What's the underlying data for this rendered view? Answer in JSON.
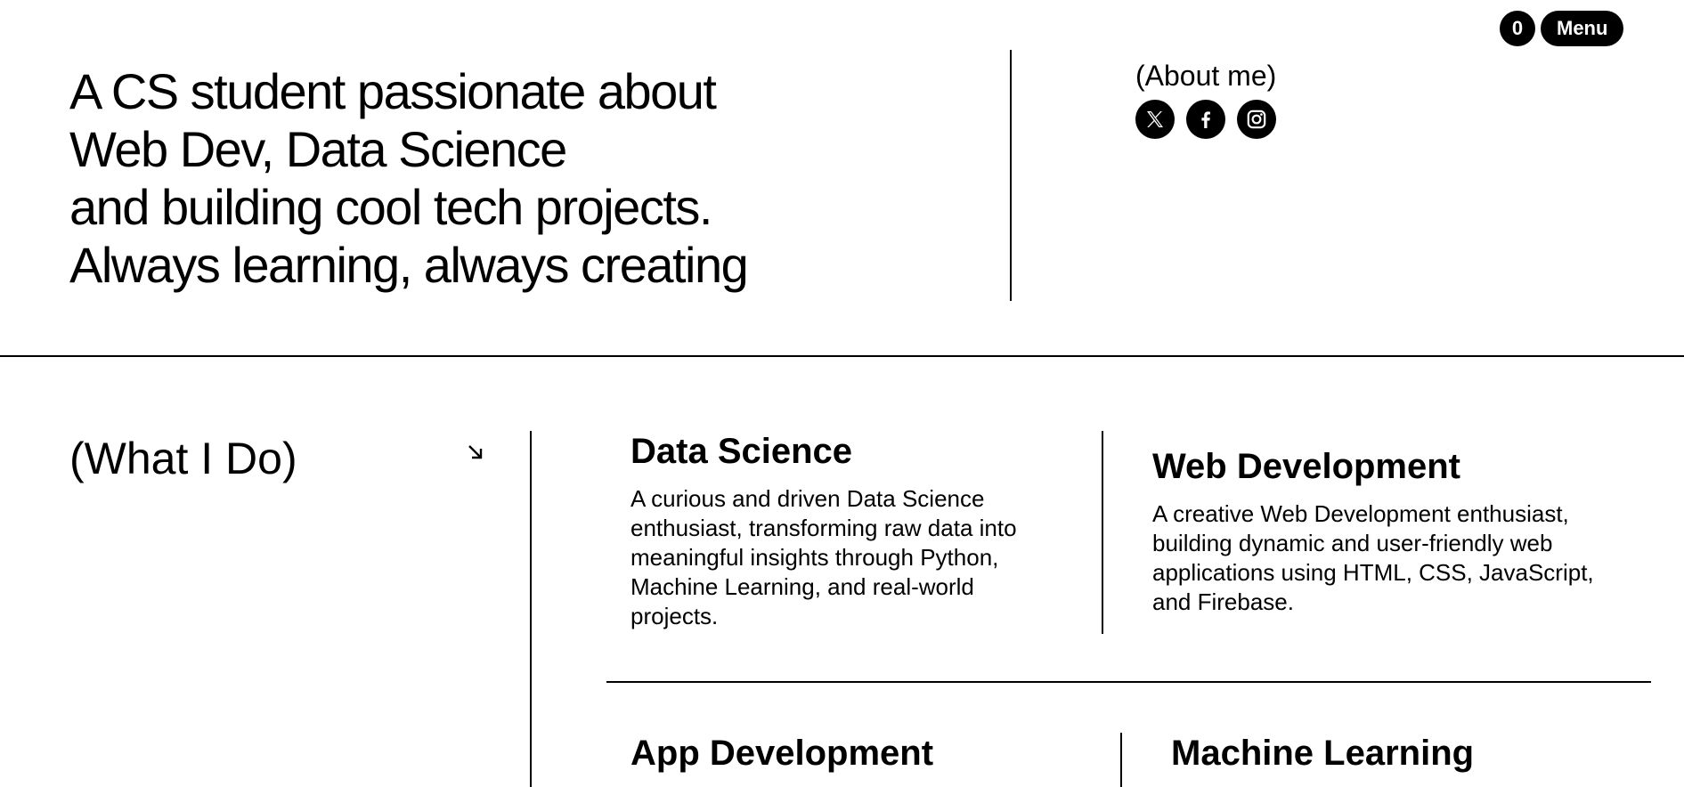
{
  "header": {
    "cart_count": "0",
    "menu_label": "Menu"
  },
  "hero": {
    "lines": [
      "A CS student passionate about",
      "Web Dev, Data Science",
      "and building cool tech projects.",
      "Always learning, always creating"
    ]
  },
  "about": {
    "label": "(About me)",
    "socials": [
      "x-icon",
      "facebook-icon",
      "instagram-icon"
    ]
  },
  "what_i_do": {
    "title": "(What I Do)",
    "arrow_icon": "arrow-down-right-icon",
    "services": [
      {
        "title": "Data Science",
        "description": "A curious and driven Data Science enthusiast, transforming raw data into meaningful insights through Python, Machine Learning, and real-world projects."
      },
      {
        "title": "Web Development",
        "description": "A creative Web Development enthusiast, building dynamic and user-friendly web applications using HTML, CSS, JavaScript, and Firebase."
      },
      {
        "title": "App Development",
        "description": ""
      },
      {
        "title": "Machine Learning",
        "description": ""
      }
    ]
  }
}
